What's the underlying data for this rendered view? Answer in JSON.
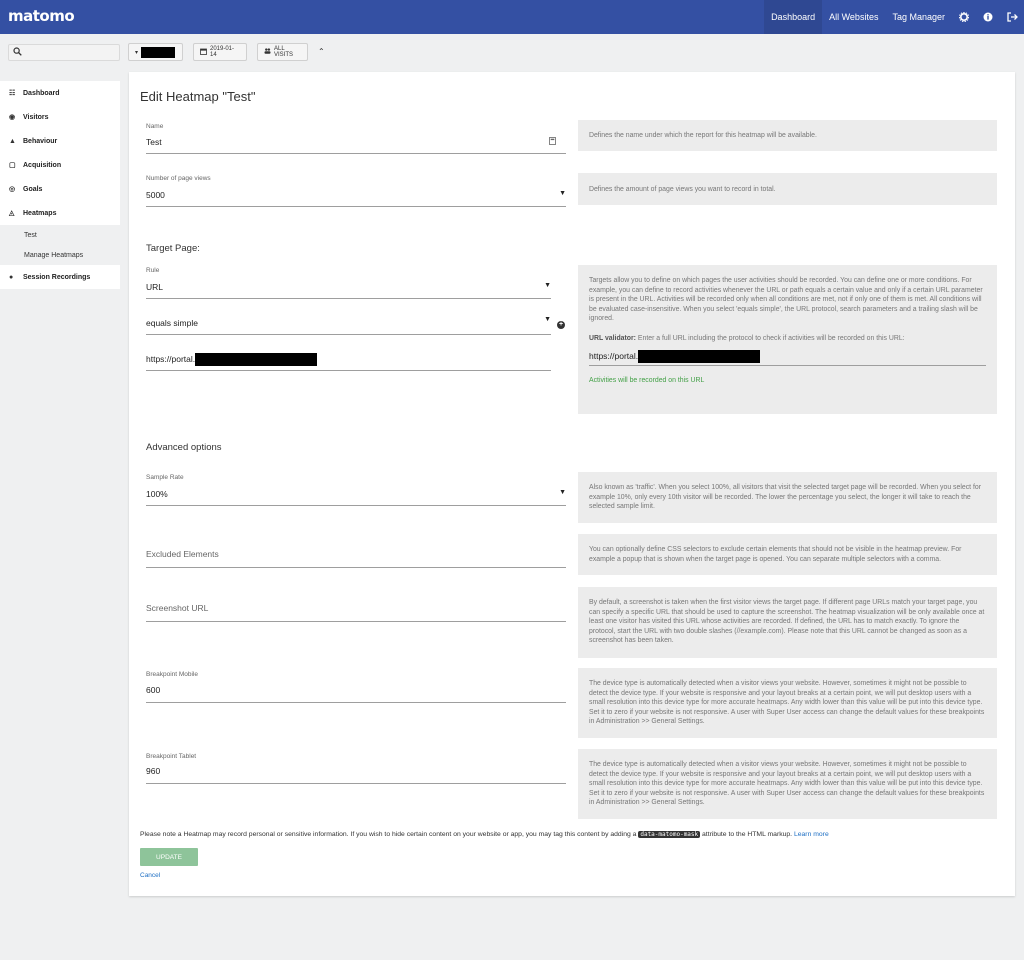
{
  "header": {
    "logo": "matomo",
    "nav": [
      "Dashboard",
      "All Websites",
      "Tag Manager"
    ],
    "icons": [
      "gear-icon",
      "help-icon",
      "sign-out-icon"
    ]
  },
  "subbar": {
    "site_selector_arrow": "▾",
    "date_label": "2019-01-14",
    "segment_label": "ALL VISITS",
    "collapse_glyph": "⌃"
  },
  "sidebar": {
    "items": [
      {
        "label": "Dashboard",
        "icon": "dashboard-icon",
        "glyph": "☷"
      },
      {
        "label": "Visitors",
        "icon": "visitors-icon",
        "glyph": "◉"
      },
      {
        "label": "Behaviour",
        "icon": "behaviour-icon",
        "glyph": "▲"
      },
      {
        "label": "Acquisition",
        "icon": "acquisition-icon",
        "glyph": "▢"
      },
      {
        "label": "Goals",
        "icon": "goals-icon",
        "glyph": "◎"
      },
      {
        "label": "Heatmaps",
        "icon": "heatmaps-icon",
        "glyph": "◬"
      }
    ],
    "subitems": [
      "Test",
      "Manage Heatmaps"
    ],
    "last_item": {
      "label": "Session Recordings",
      "icon": "recordings-icon",
      "glyph": "●"
    }
  },
  "main": {
    "title": "Edit Heatmap \"Test\"",
    "name_label": "Name",
    "name_value": "Test",
    "name_help": "Defines the name under which the report for this heatmap will be available.",
    "pageviews_label": "Number of page views",
    "pageviews_value": "5000",
    "pageviews_help": "Defines the amount of page views you want to record in total.",
    "target_title": "Target Page:",
    "rule_label": "Rule",
    "rule_value": "URL",
    "match_value": "equals simple",
    "url_value": "https://portal.",
    "target_help": "Targets allow you to define on which pages the user activities should be recorded. You can define one or more conditions. For example, you can define to record activities whenever the URL or path equals a certain value and only if a certain URL parameter is present in the URL. Activities will be recorded only when all conditions are met, not if only one of them is met. All conditions will be evaluated case-insensitive. When you select 'equals simple', the URL protocol, search parameters and a trailing slash will be ignored.",
    "validator_label": "URL validator:",
    "validator_text": "Enter a full URL including the protocol to check if activities will be recorded on this URL:",
    "validator_url": "https://portal.",
    "validator_result": "Activities will be recorded on this URL",
    "advanced_title": "Advanced options",
    "sample_label": "Sample Rate",
    "sample_value": "100%",
    "sample_help": "Also known as 'traffic'. When you select 100%, all visitors that visit the selected target page will be recorded. When you select for example 10%, only every 10th visitor will be recorded. The lower the percentage you select, the longer it will take to reach the selected sample limit.",
    "excluded_placeholder": "Excluded Elements",
    "excluded_help": "You can optionally define CSS selectors to exclude certain elements that should not be visible in the heatmap preview. For example a popup that is shown when the target page is opened. You can separate multiple selectors with a comma.",
    "screenshot_placeholder": "Screenshot URL",
    "screenshot_help": "By default, a screenshot is taken when the first visitor views the target page. If different page URLs match your target page, you can specify a specific URL that should be used to capture the screenshot. The heatmap visualization will be only available once at least one visitor has visited this URL whose activities are recorded. If defined, the URL has to match exactly. To ignore the protocol, start the URL with two double slashes (//example.com). Please note that this URL cannot be changed as soon as a screenshot has been taken.",
    "bp_mobile_label": "Breakpoint Mobile",
    "bp_mobile_value": "600",
    "bp_tablet_label": "Breakpoint Tablet",
    "bp_tablet_value": "960",
    "bp_help": "The device type is automatically detected when a visitor views your website. However, sometimes it might not be possible to detect the device type. If your website is responsive and your layout breaks at a certain point, we will put desktop users with a small resolution into this device type for more accurate heatmaps. Any width lower than this value will be put into this device type. Set it to zero if your website is not responsive. A user with Super User access can change the default values for these breakpoints in Administration >> General Settings.",
    "note_before": "Please note a Heatmap may record personal or sensitive information. If you wish to hide certain content on your website or app, you may tag this content by adding a",
    "note_code": "data-matomo-mask",
    "note_after": "attribute to the HTML markup.",
    "note_link": "Learn more",
    "update_label": "UPDATE",
    "cancel_label": "Cancel"
  }
}
